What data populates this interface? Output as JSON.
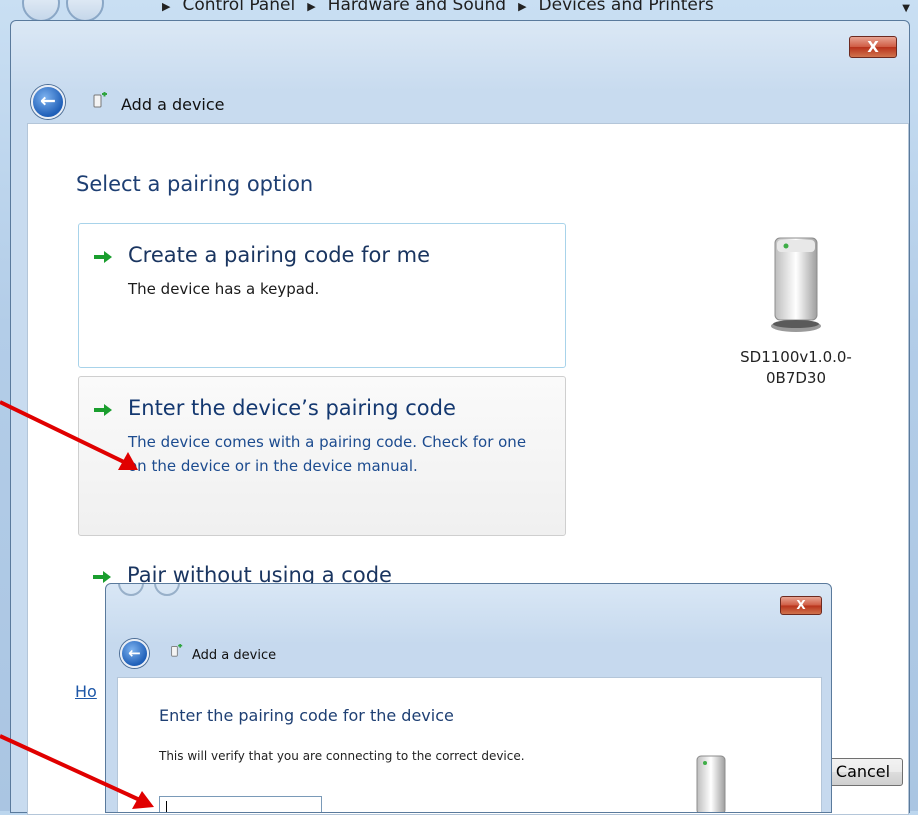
{
  "explorer": {
    "breadcrumb": [
      "Control Panel",
      "Hardware and Sound",
      "Devices and Printers"
    ]
  },
  "dialog": {
    "close_label": "X",
    "title": "Add a device",
    "heading": "Select a pairing option",
    "options": [
      {
        "title": "Create a pairing code for me",
        "description": "The device has a keypad."
      },
      {
        "title": "Enter the device’s pairing code",
        "description": "The device comes with a pairing code. Check for one on the device or in the device manual."
      },
      {
        "title": "Pair without using a code",
        "description": ""
      }
    ],
    "device_name": "SD1100v1.0.0-0B7D30",
    "help_link": "Ho",
    "cancel_label": "Cancel"
  },
  "overlay": {
    "close_label": "X",
    "title": "Add a device",
    "heading": "Enter the pairing code for the device",
    "text": "This will verify that you are connecting to the correct device.",
    "input_value": ""
  },
  "colors": {
    "annotation_arrow": "#e00000",
    "option_arrow": "#1a9e2e",
    "heading": "#1e3f73",
    "link": "#1d57a8"
  },
  "icons": [
    "back-arrow-icon",
    "add-device-icon",
    "green-arrow-icon",
    "device-tower-icon",
    "close-icon"
  ]
}
